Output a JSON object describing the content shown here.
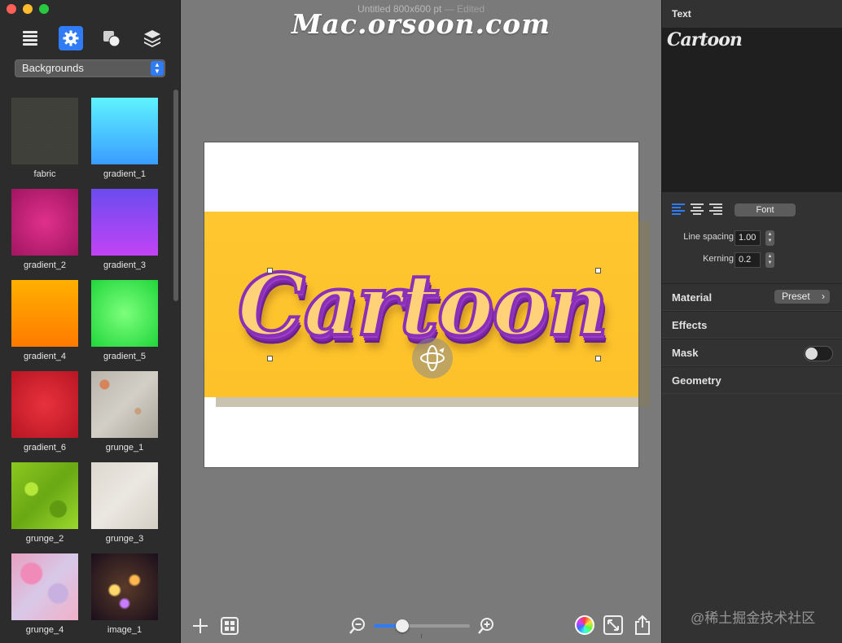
{
  "window": {
    "title": "Untitled 800x600 pt",
    "title_suffix": "— Edited"
  },
  "watermark": "Mac.orsoon.com",
  "corner_watermark": "@稀土掘金技术社区",
  "sidebar": {
    "toolbar": [
      {
        "name": "list-icon",
        "active": false
      },
      {
        "name": "gear-icon",
        "active": true
      },
      {
        "name": "shapes-icon",
        "active": false
      },
      {
        "name": "layers-icon",
        "active": false
      }
    ],
    "category_select": "Backgrounds",
    "thumbnails": [
      {
        "label": "fabric"
      },
      {
        "label": "gradient_1"
      },
      {
        "label": "gradient_2"
      },
      {
        "label": "gradient_3"
      },
      {
        "label": "gradient_4"
      },
      {
        "label": "gradient_5"
      },
      {
        "label": "gradient_6"
      },
      {
        "label": "grunge_1"
      },
      {
        "label": "grunge_2"
      },
      {
        "label": "grunge_3"
      },
      {
        "label": "grunge_4"
      },
      {
        "label": "image_1"
      }
    ]
  },
  "canvas": {
    "text": "Cartoon",
    "zoom_fraction": 0.3
  },
  "inspector": {
    "text_header": "Text",
    "text_content": "Cartoon",
    "font_button": "Font",
    "line_spacing_label": "Line spacing",
    "line_spacing_value": "1.00",
    "kerning_label": "Kerning",
    "kerning_value": "0.2",
    "sections": {
      "material": "Material",
      "preset": "Preset",
      "effects": "Effects",
      "mask": "Mask",
      "geometry": "Geometry"
    },
    "mask_enabled": false
  },
  "colors": {
    "accent": "#2f7cf6",
    "banner": "#fdc22a",
    "text_stroke": "#8a2fb8"
  }
}
